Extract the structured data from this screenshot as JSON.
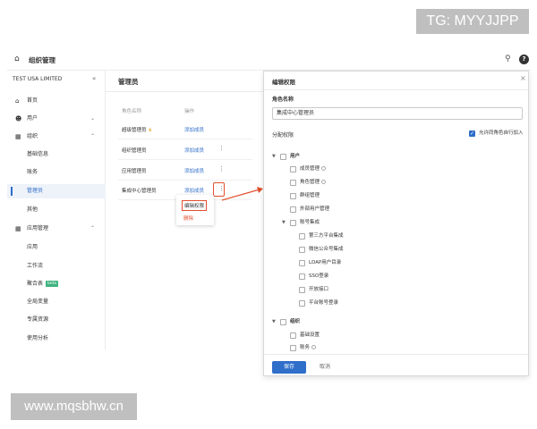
{
  "watermarks": {
    "tg": "TG: MYYJJPP",
    "url": "www.mqsbhw.cn"
  },
  "topbar": {
    "title": "组织管理"
  },
  "sidebar": {
    "org_name": "TEST USA LIMITED",
    "items": [
      {
        "label": "首页",
        "icon": "home-icon"
      },
      {
        "label": "用户",
        "icon": "users-icon",
        "chevron": "down"
      },
      {
        "label": "组织",
        "icon": "org-icon",
        "chevron": "up"
      },
      {
        "label": "基础信息"
      },
      {
        "label": "账务"
      },
      {
        "label": "管理员",
        "active": true
      },
      {
        "label": "其他"
      },
      {
        "label": "应用管理",
        "icon": "apps-icon",
        "chevron": "up"
      },
      {
        "label": "应用"
      },
      {
        "label": "工作流"
      },
      {
        "label": "聚合表",
        "badge": "beta"
      },
      {
        "label": "全局变量"
      },
      {
        "label": "专属资源"
      },
      {
        "label": "使用分析"
      }
    ]
  },
  "main": {
    "title": "管理员",
    "col_name": "角色名称",
    "col_action": "操作",
    "rows": [
      {
        "name": "超级管理员",
        "action": "添加成员",
        "crown": true
      },
      {
        "name": "组织管理员",
        "action": "添加成员"
      },
      {
        "name": "应用管理员",
        "action": "添加成员"
      },
      {
        "name": "集成中心管理员",
        "action": "添加成员"
      }
    ],
    "menu": {
      "edit": "编辑权限",
      "delete": "删除"
    }
  },
  "panel": {
    "title": "编辑权限",
    "role_name_label": "角色名称",
    "role_name_value": "集成中心管理员",
    "perm_label": "分配权限",
    "allow_join": "允许同角色自行加入",
    "tree": {
      "user": "用户",
      "member_mgmt": "成员管理",
      "role_mgmt": "角色管理",
      "group_mgmt": "群组管理",
      "external_user_mgmt": "外部用户管理",
      "account_integration": "账号集成",
      "third_party": "第三方平台集成",
      "wechat": "微信公众号集成",
      "ldap": "LDAP用户目录",
      "sso": "SSO登录",
      "open_api": "开放接口",
      "platform_login": "平台账号登录",
      "org": "组织",
      "basic_settings": "基础设置",
      "billing": "账务"
    },
    "save": "保存",
    "cancel": "取消"
  }
}
